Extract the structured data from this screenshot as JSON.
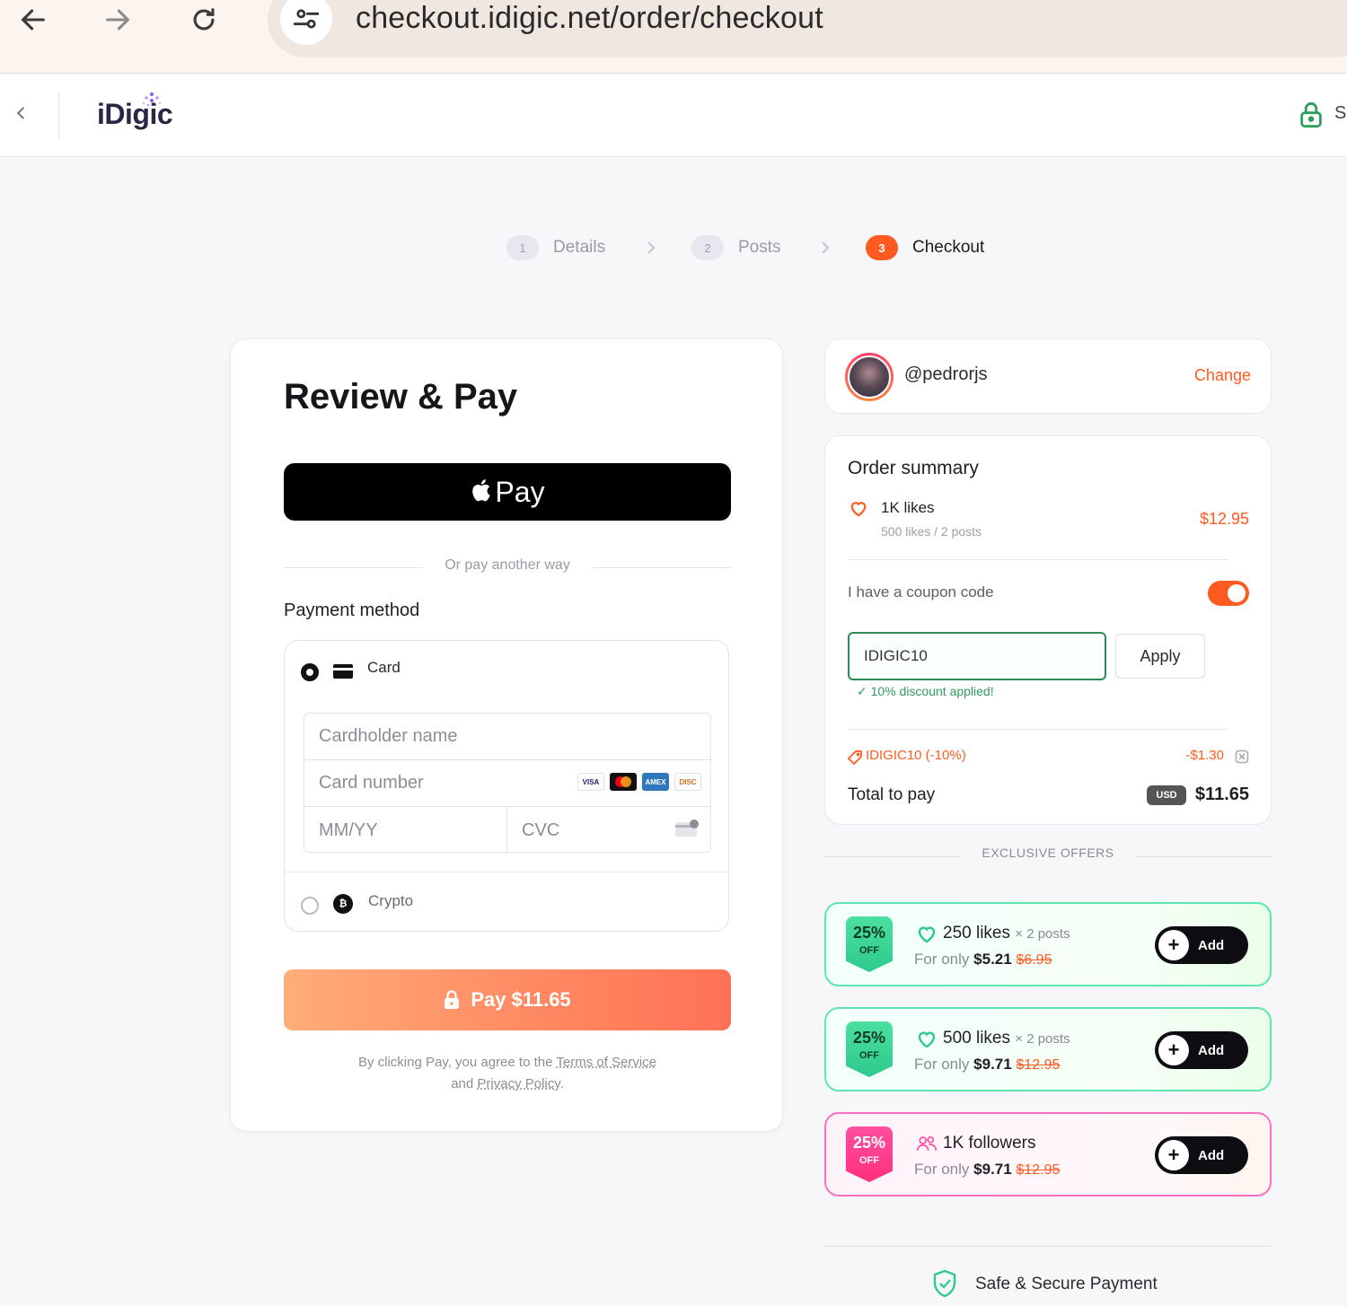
{
  "browser": {
    "url": "checkout.idigic.net/order/checkout"
  },
  "header": {
    "logo": "iDigic",
    "secure_label": "S"
  },
  "steps": [
    {
      "num": "1",
      "label": "Details"
    },
    {
      "num": "2",
      "label": "Posts"
    },
    {
      "num": "3",
      "label": "Checkout"
    }
  ],
  "payment": {
    "title": "Review & Pay",
    "apple_pay_label": "Pay",
    "or_text": "Or pay another way",
    "method_label": "Payment method",
    "card_label": "Card",
    "cardholder_placeholder": "Cardholder name",
    "card_number_placeholder": "Card number",
    "expiry_placeholder": "MM/YY",
    "cvc_placeholder": "CVC",
    "crypto_label": "Crypto",
    "pay_button": "Pay $11.65",
    "legal_prefix": "By clicking Pay, you agree to the",
    "terms_link": "Terms of Service",
    "legal_and": "and",
    "privacy_link": "Privacy Policy",
    "legal_end": ".",
    "card_brands": [
      "VISA",
      "MC",
      "AMEX",
      "DISC"
    ]
  },
  "account": {
    "username": "@pedrorjs",
    "change_label": "Change"
  },
  "summary": {
    "title": "Order summary",
    "item_name": "1K likes",
    "item_sub": "500 likes / 2 posts",
    "item_price": "$12.95",
    "coupon_label": "I have a coupon code",
    "coupon_value": "IDIGIC10",
    "apply_label": "Apply",
    "discount_msg": "✓ 10% discount applied!",
    "discount_code": "IDIGIC10 (-10%)",
    "discount_amount": "-$1.30",
    "total_label": "Total to pay",
    "currency_badge": "USD",
    "total_amount": "$11.65"
  },
  "offers_heading": "EXCLUSIVE OFFERS",
  "offers": [
    {
      "badge_pct": "25%",
      "badge_off": "OFF",
      "title": "250 likes",
      "multiplier": "× 2 posts",
      "price_prefix": "For only",
      "price": "$5.21",
      "old_price": "$6.95",
      "add_label": "Add",
      "theme": "green"
    },
    {
      "badge_pct": "25%",
      "badge_off": "OFF",
      "title": "500 likes",
      "multiplier": "× 2 posts",
      "price_prefix": "For only",
      "price": "$9.71",
      "old_price": "$12.95",
      "add_label": "Add",
      "theme": "green"
    },
    {
      "badge_pct": "25%",
      "badge_off": "OFF",
      "title": "1K followers",
      "multiplier": "",
      "price_prefix": "For only",
      "price": "$9.71",
      "old_price": "$12.95",
      "add_label": "Add",
      "theme": "pink"
    }
  ],
  "footer": {
    "secure_text": "Safe & Secure Payment"
  },
  "colors": {
    "accent": "#ff5a1f",
    "success": "#2e9e5c",
    "offer_green": "#5ee6b0",
    "offer_pink": "#ff6ec4"
  }
}
